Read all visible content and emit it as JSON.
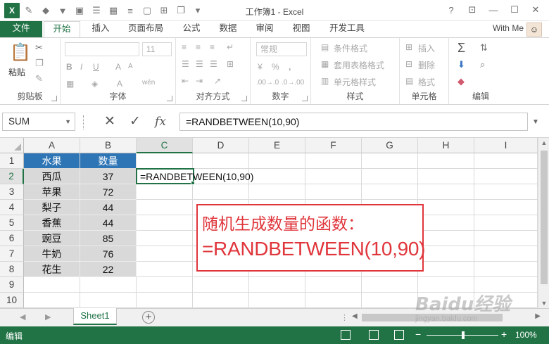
{
  "titlebar": {
    "title": "工作簿1 - Excel",
    "qat_icons": [
      "excel-logo-icon",
      "brush-icon",
      "eraser-icon",
      "filter-icon",
      "image-icon",
      "align-icon",
      "table-icon",
      "align-center-icon",
      "border-icon",
      "merge-icon",
      "copy-icon",
      "chevron-down-icon"
    ],
    "controls": [
      "?",
      "restore-ribbon",
      "minimize",
      "maximize",
      "close"
    ],
    "logo_text": "X"
  },
  "ribbon": {
    "tabs": [
      "文件",
      "开始",
      "插入",
      "页面布局",
      "公式",
      "数据",
      "审阅",
      "视图",
      "开发工具"
    ],
    "active_tab": "开始",
    "account": "With Me",
    "groups": {
      "clipboard": {
        "label": "剪贴板",
        "paste": "粘贴"
      },
      "font": {
        "label": "字体",
        "font_size": "11"
      },
      "alignment": {
        "label": "对齐方式"
      },
      "number": {
        "label": "数字",
        "format": "常规",
        "percent": "%",
        "comma": ",",
        "decrease": ".00→.0",
        "increase": ".0→.00"
      },
      "styles": {
        "label": "样式",
        "items": [
          "条件格式",
          "套用表格格式",
          "单元格样式"
        ]
      },
      "cells": {
        "label": "单元格",
        "items": [
          "插入",
          "删除",
          "格式"
        ]
      },
      "editing": {
        "label": "编辑"
      }
    }
  },
  "formula_bar": {
    "name_box": "SUM",
    "cancel": "✕",
    "enter": "✓",
    "fx": "fx",
    "formula": "=RANDBETWEEN(10,90)"
  },
  "sheet": {
    "columns": [
      "A",
      "B",
      "C",
      "D",
      "E",
      "F",
      "G",
      "H",
      "I"
    ],
    "rows": [
      "1",
      "2",
      "3",
      "4",
      "5",
      "6",
      "7",
      "8",
      "9",
      "10"
    ],
    "active_column": "C",
    "active_row": "2",
    "headers": [
      "水果",
      "数量"
    ],
    "data": [
      [
        "西瓜",
        "37"
      ],
      [
        "苹果",
        "72"
      ],
      [
        "梨子",
        "44"
      ],
      [
        "香蕉",
        "44"
      ],
      [
        "豌豆",
        "85"
      ],
      [
        "牛奶",
        "76"
      ],
      [
        "花生",
        "22"
      ]
    ],
    "editing_text": "=RANDBETWEEN(10,90)",
    "header_color": "#2e75b6",
    "data_fill": "#d9d9d9"
  },
  "annotation": {
    "line1": "随机生成数量的函数：",
    "line2": "=RANDBETWEEN(10,90)",
    "color": "#e0353b"
  },
  "sheet_tabs": {
    "tabs": [
      "Sheet1"
    ],
    "add": "+"
  },
  "statusbar": {
    "mode": "编辑",
    "zoom": "100%",
    "zoom_minus": "−",
    "zoom_plus": "+"
  },
  "watermark": {
    "brand": "Baidu经验",
    "sub": "jingyan.baidu.com"
  }
}
